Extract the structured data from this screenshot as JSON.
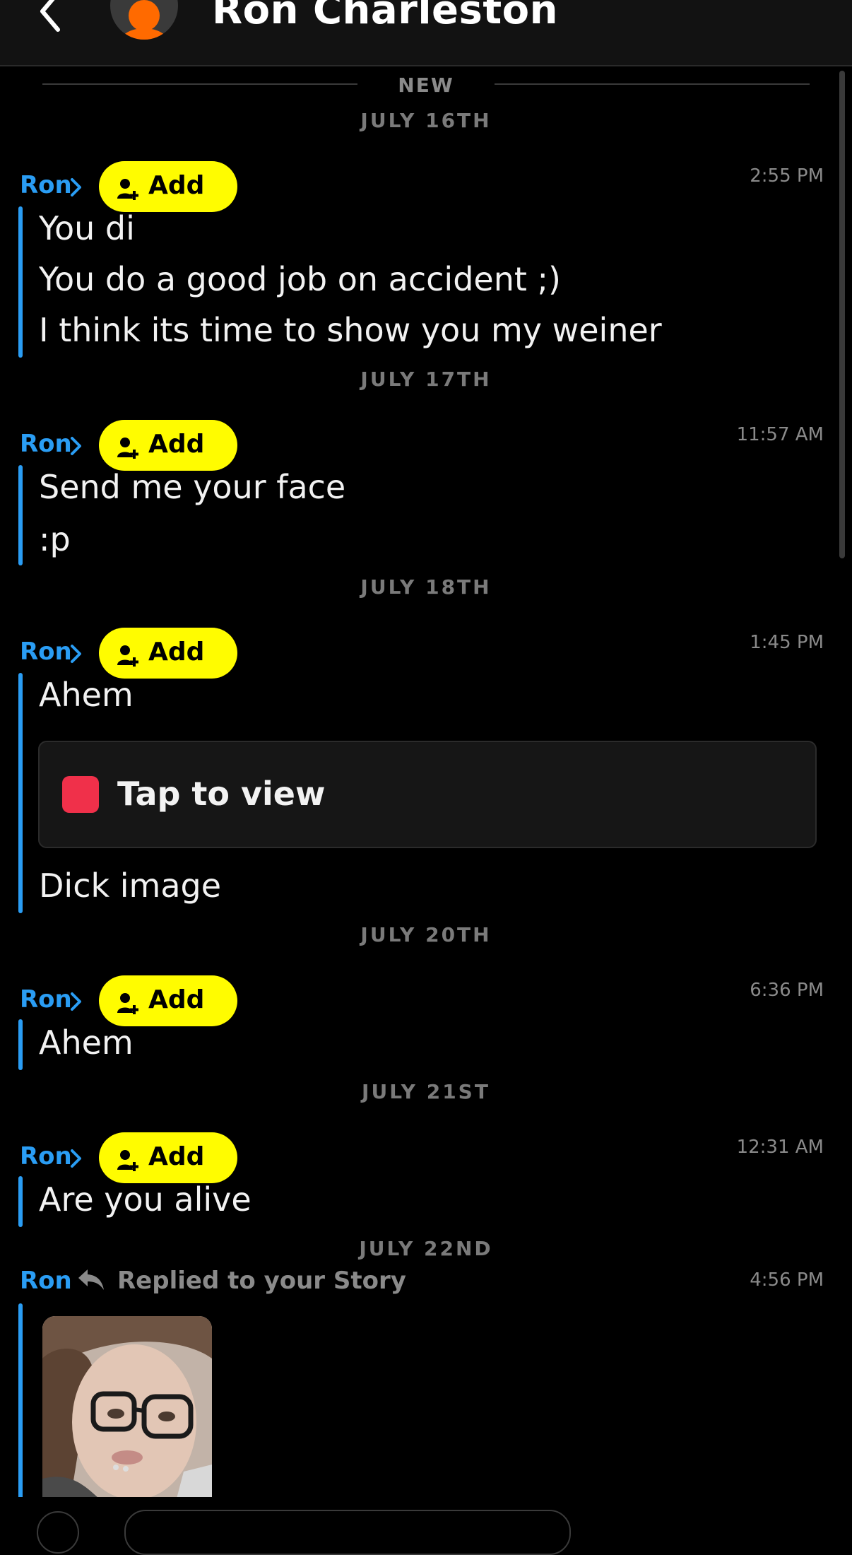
{
  "header": {
    "title": "Ron Charleston"
  },
  "divider_new": "NEW",
  "sender_name": "Ron",
  "add_label": "Add",
  "tap_to_view": "Tap to view",
  "groups": [
    {
      "date": "JULY 16TH",
      "time": "2:55 PM",
      "messages": [
        "You di",
        "You do a good job on accident ;)",
        "I think its time to show you my weiner"
      ]
    },
    {
      "date": "JULY 17TH",
      "time": "11:57 AM",
      "messages": [
        "Send me your face",
        ":p"
      ]
    },
    {
      "date": "JULY 18TH",
      "time": "1:45 PM",
      "messages": [
        "Ahem",
        "Dick image"
      ]
    },
    {
      "date": "JULY 20TH",
      "time": "6:36 PM",
      "messages": [
        "Ahem"
      ]
    },
    {
      "date": "JULY 21ST",
      "time": "12:31 AM",
      "messages": [
        "Are you alive"
      ]
    },
    {
      "date": "JULY 22ND",
      "time": "4:56 PM",
      "story_reply": "Replied to your Story"
    }
  ],
  "colors": {
    "accent_blue": "#2a9df4",
    "add_yellow": "#fffc00",
    "snap_red": "#f0304a",
    "background": "#000000"
  },
  "icons": {
    "back": "chevron-left-icon",
    "add": "add-friend-icon",
    "reply": "reply-arrow-icon",
    "chevron": "chevron-right-icon"
  }
}
